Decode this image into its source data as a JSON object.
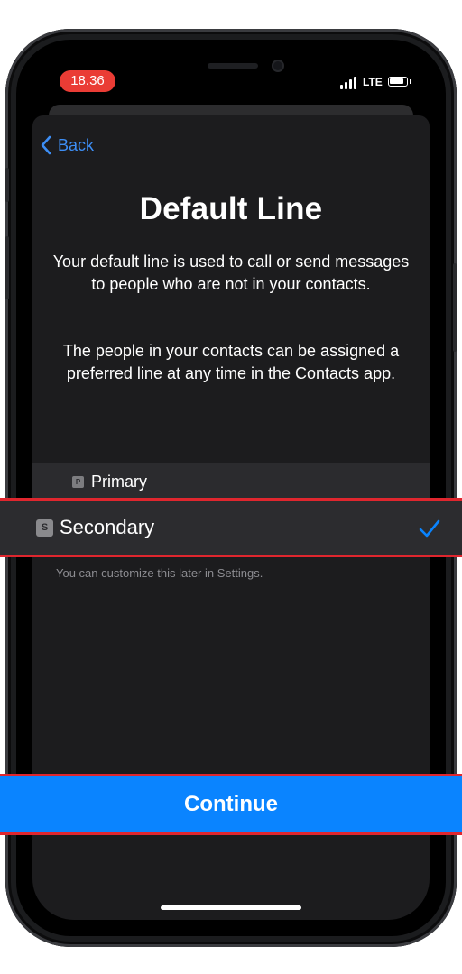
{
  "status_bar": {
    "time": "18.36",
    "network": "LTE"
  },
  "nav": {
    "back_label": "Back"
  },
  "page": {
    "title": "Default Line",
    "description_1": "Your default line is used to call or send messages to people who are not in your contacts.",
    "description_2": "The people in your contacts can be assigned a preferred line at any time in the Contacts app."
  },
  "lines": [
    {
      "badge": "P",
      "label": "Primary",
      "selected": false
    },
    {
      "badge": "S",
      "label": "Secondary",
      "selected": true
    }
  ],
  "hint": "You can customize this later in Settings.",
  "actions": {
    "continue_label": "Continue"
  },
  "colors": {
    "accent": "#0a84ff",
    "highlight": "#e0262e",
    "time_pill": "#ea3c35"
  }
}
